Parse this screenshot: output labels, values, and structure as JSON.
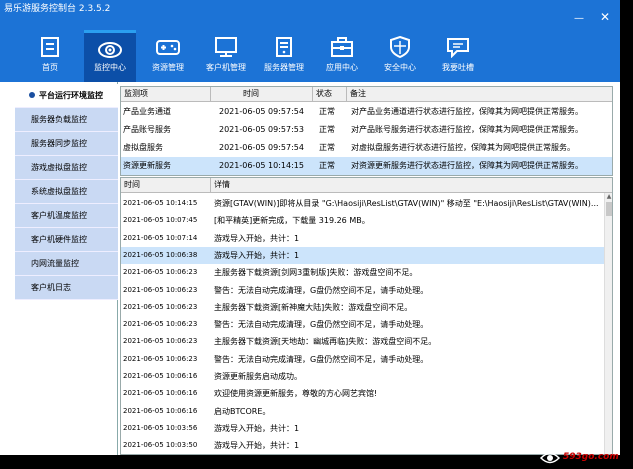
{
  "app": {
    "title": "易乐游服务控制台 2.3.5.2"
  },
  "window_controls": {
    "minimize": "—",
    "close": "✕"
  },
  "toolbar": [
    {
      "label": "首页",
      "icon": "home-icon"
    },
    {
      "label": "监控中心",
      "icon": "eye-icon",
      "active": true
    },
    {
      "label": "资源管理",
      "icon": "gamepad-icon"
    },
    {
      "label": "客户机管理",
      "icon": "monitor-icon"
    },
    {
      "label": "服务器管理",
      "icon": "server-icon"
    },
    {
      "label": "应用中心",
      "icon": "toolbox-icon"
    },
    {
      "label": "安全中心",
      "icon": "shield-icon"
    },
    {
      "label": "我要吐槽",
      "icon": "speech-bubble-icon"
    }
  ],
  "sidebar": {
    "items": [
      {
        "label": "平台运行环境监控",
        "active": true
      },
      {
        "label": "服务器负载监控"
      },
      {
        "label": "服务器同步监控"
      },
      {
        "label": "游戏虚拟盘监控"
      },
      {
        "label": "系统虚拟盘监控"
      },
      {
        "label": "客户机温度监控"
      },
      {
        "label": "客户机硬件监控"
      },
      {
        "label": "内网流量监控"
      },
      {
        "label": "客户机日志"
      }
    ]
  },
  "task_table": {
    "headers": [
      "监测项",
      "时间",
      "状态",
      "备注"
    ],
    "rows": [
      {
        "item": "产品业务通道",
        "time": "2021-06-05 09:57:54",
        "status": "正常",
        "note": "对产品业务通道进行状态进行监控，保障其为网吧提供正常服务。"
      },
      {
        "item": "产品账号服务",
        "time": "2021-06-05 09:57:53",
        "status": "正常",
        "note": "对产品账号服务进行状态进行监控，保障其为网吧提供正常服务。"
      },
      {
        "item": "虚拟盘服务",
        "time": "2021-06-05 09:57:54",
        "status": "正常",
        "note": "对虚拟盘服务进行状态进行监控，保障其为网吧提供正常服务。"
      },
      {
        "item": "资源更新服务",
        "time": "2021-06-05 10:14:15",
        "status": "正常",
        "note": "对资源更新服务进行状态进行监控，保障其为网吧提供正常服务。",
        "selected": true
      }
    ]
  },
  "log_table": {
    "headers": [
      "时间",
      "详情"
    ],
    "rows": [
      {
        "time": "2021-06-05 10:14:15",
        "detail": "资源[GTAV(WIN)]即将从目录 \"G:\\Haosiji\\ResList\\GTAV(WIN)\" 移动至 \"E:\\Haosiji\\ResList\\GTAV(WIN)..."
      },
      {
        "time": "2021-06-05 10:07:45",
        "detail": "[和平精英]更新完成，下载量 319.26 MB。"
      },
      {
        "time": "2021-06-05 10:07:14",
        "detail": "游戏导入开始，共计：1"
      },
      {
        "time": "2021-06-05 10:06:38",
        "detail": "游戏导入开始，共计：1",
        "selected": true
      },
      {
        "time": "2021-06-05 10:06:23",
        "detail": "主服务器下载资源[剑网3重制版]失败：游戏盘空间不足。"
      },
      {
        "time": "2021-06-05 10:06:23",
        "detail": "警告：无法自动完成清理，G盘仍然空间不足，请手动处理。"
      },
      {
        "time": "2021-06-05 10:06:23",
        "detail": "主服务器下载资源[新神魔大陆]失败：游戏盘空间不足。"
      },
      {
        "time": "2021-06-05 10:06:23",
        "detail": "警告：无法自动完成清理，G盘仍然空间不足，请手动处理。"
      },
      {
        "time": "2021-06-05 10:06:23",
        "detail": "主服务器下载资源[天地劫：幽城再临]失败：游戏盘空间不足。"
      },
      {
        "time": "2021-06-05 10:06:23",
        "detail": "警告：无法自动完成清理，G盘仍然空间不足，请手动处理。"
      },
      {
        "time": "2021-06-05 10:06:16",
        "detail": "资源更新服务启动成功。"
      },
      {
        "time": "2021-06-05 10:06:16",
        "detail": "欢迎使用资源更新服务，尊敬的方心网艺宾馆!"
      },
      {
        "time": "2021-06-05 10:06:16",
        "detail": "启动BTCORE。"
      },
      {
        "time": "2021-06-05 10:03:56",
        "detail": "游戏导入开始，共计：1"
      },
      {
        "time": "2021-06-05 10:03:50",
        "detail": "游戏导入开始，共计：1"
      }
    ]
  },
  "watermark": {
    "text": "593go.com"
  },
  "colors": {
    "header_blue": "#1c73d6",
    "active_tab": "#0c4fa8",
    "sidebar_bg": "#c9d9f3",
    "selection": "#cce4fb"
  }
}
